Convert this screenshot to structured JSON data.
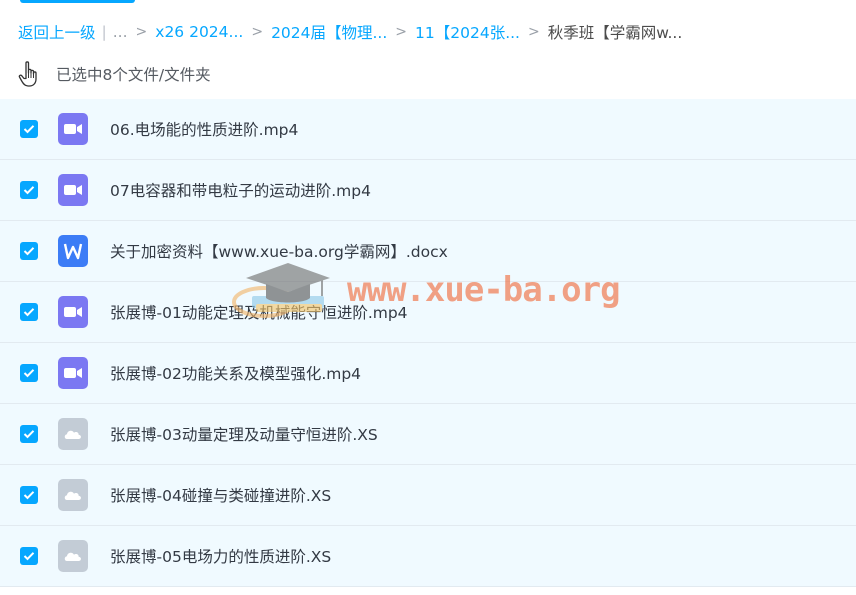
{
  "breadcrumb": {
    "back_label": "返回上一级",
    "divider": "|",
    "ellipsis": "...",
    "items": [
      "x26 2024...",
      "2024届【物理...",
      "11【2024张...",
      "秋季班【学霸网w..."
    ]
  },
  "selection": {
    "text": "已选中8个文件/文件夹"
  },
  "files": [
    {
      "name": "06.电场能的性质进阶.mp4",
      "type": "video",
      "checked": true
    },
    {
      "name": "07电容器和带电粒子的运动进阶.mp4",
      "type": "video",
      "checked": true
    },
    {
      "name": "关于加密资料【www.xue-ba.org学霸网】.docx",
      "type": "word",
      "checked": true
    },
    {
      "name": "张展博-01动能定理及机械能守恒进阶.mp4",
      "type": "video",
      "checked": true
    },
    {
      "name": "张展博-02功能关系及模型强化.mp4",
      "type": "video",
      "checked": true
    },
    {
      "name": "张展博-03动量定理及动量守恒进阶.XS",
      "type": "cloud",
      "checked": true
    },
    {
      "name": "张展博-04碰撞与类碰撞进阶.XS",
      "type": "cloud",
      "checked": true
    },
    {
      "name": "张展博-05电场力的性质进阶.XS",
      "type": "cloud",
      "checked": true
    }
  ],
  "watermark": {
    "text": "www.xue-ba.org"
  },
  "icons": {
    "hand": "pointer-hand-icon",
    "video": "video-file-icon",
    "word": "word-doc-icon",
    "cloud": "cloud-file-icon",
    "check": "checkmark-icon"
  },
  "colors": {
    "accent": "#06a7ff",
    "row_bg": "#f0faff",
    "video_icon": "#7b78f2",
    "word_icon": "#3c7cf6",
    "cloud_icon": "#c3ccd6"
  }
}
